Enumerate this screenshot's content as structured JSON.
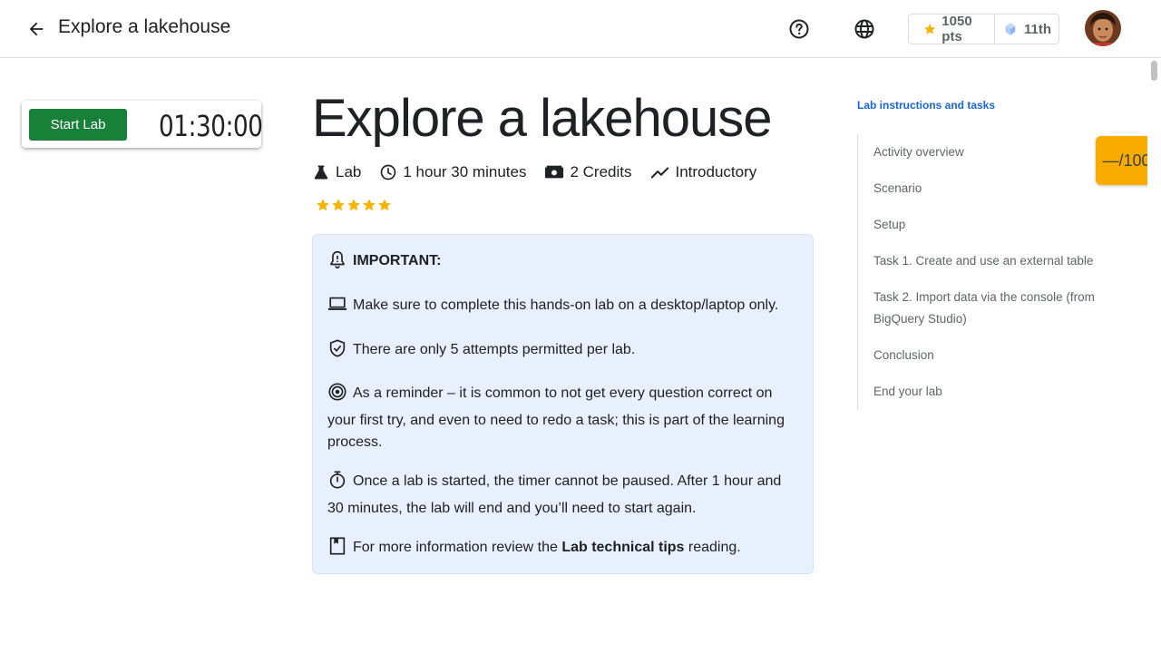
{
  "header": {
    "title": "Explore a lakehouse",
    "points": "1050 pts",
    "rank": "11th"
  },
  "lab_panel": {
    "start_label": "Start Lab",
    "timer": "01:30:00"
  },
  "main": {
    "title": "Explore a lakehouse",
    "meta": {
      "type": "Lab",
      "duration": "1 hour 30 minutes",
      "credits": "2 Credits",
      "level": "Introductory"
    },
    "rating_stars": 5,
    "callout": {
      "heading": "IMPORTANT:",
      "line1": "Make sure to complete this hands-on lab on a desktop/laptop only.",
      "line2": "There are only 5 attempts permitted per lab.",
      "line3": "As a reminder – it is common to not get every question correct on your first try, and even to need to redo a task; this is part of the learning process.",
      "line4": "Once a lab is started, the timer cannot be paused. After 1 hour and 30 minutes, the lab will end and you’ll need to start again.",
      "line5_pre": "For more information review the ",
      "line5_bold": "Lab technical tips",
      "line5_post": " reading."
    }
  },
  "toc": {
    "heading": "Lab instructions and tasks",
    "items": [
      "Activity overview",
      "Scenario",
      "Setup",
      "Task 1. Create and use an external table",
      "Task 2. Import data via the console (from BigQuery Studio)",
      "Conclusion",
      "End your lab"
    ]
  },
  "score": "—/100",
  "colors": {
    "start_button": "#188038",
    "callout_bg": "#e8f0fe",
    "score_tab": "#f9ab00",
    "toc_heading": "#1967d2",
    "star": "#f4b400"
  }
}
